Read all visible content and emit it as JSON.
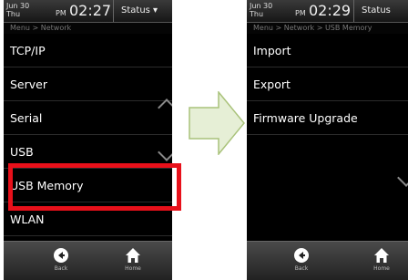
{
  "left_screen": {
    "date_line1": "Jun 30",
    "date_line2": "Thu",
    "ampm": "PM",
    "time": "02:27",
    "status_label": "Status ▾",
    "breadcrumb": "Menu > Network",
    "items": [
      "TCP/IP",
      "Server",
      "Serial",
      "USB",
      "USB Memory",
      "WLAN"
    ],
    "highlighted_item": "USB Memory",
    "back_label": "Back",
    "home_label": "Home"
  },
  "right_screen": {
    "date_line1": "Jun 30",
    "date_line2": "Thu",
    "ampm": "PM",
    "time": "02:29",
    "status_label": "Status",
    "breadcrumb": "Menu > Network > USB Memory",
    "items": [
      "Import",
      "Export",
      "Firmware Upgrade"
    ],
    "back_label": "Back",
    "home_label": "Home"
  },
  "colors": {
    "highlight_border": "#e8101a",
    "arrow_fill": "#e6efd6",
    "arrow_stroke": "#a9c27a"
  },
  "icons": {
    "back": "back-arrow-circle-icon",
    "home": "home-icon",
    "scroll_up": "chevron-up-icon",
    "scroll_down": "chevron-down-icon",
    "transition": "right-arrow-icon"
  }
}
